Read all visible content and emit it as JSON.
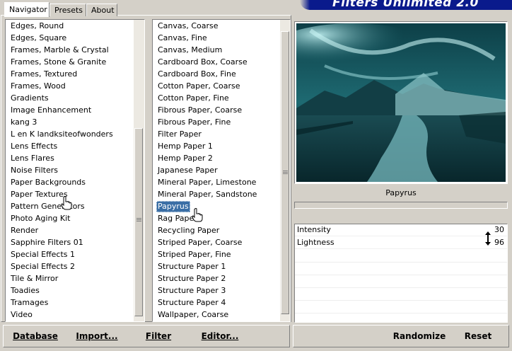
{
  "banner": {
    "title": "Filters Unlimited 2.0"
  },
  "tabs": [
    {
      "label": "Navigator",
      "active": true
    },
    {
      "label": "Presets",
      "active": false
    },
    {
      "label": "About",
      "active": false
    }
  ],
  "categories": {
    "items": [
      "Edges, Round",
      "Edges, Square",
      "Frames, Marble & Crystal",
      "Frames, Stone & Granite",
      "Frames, Textured",
      "Frames, Wood",
      "Gradients",
      "Image Enhancement",
      "kang 3",
      "L en K landksiteofwonders",
      "Lens Effects",
      "Lens Flares",
      "Noise Filters",
      "Paper Backgrounds",
      "Paper Textures",
      "Pattern Generators",
      "Photo Aging Kit",
      "Render",
      "Sapphire Filters 01",
      "Special Effects 1",
      "Special Effects 2",
      "Tile & Mirror",
      "Toadies",
      "Tramages",
      "Video"
    ],
    "hover_item": "Paper Textures"
  },
  "filters": {
    "items": [
      "Canvas, Coarse",
      "Canvas, Fine",
      "Canvas, Medium",
      "Cardboard Box, Coarse",
      "Cardboard Box, Fine",
      "Cotton Paper, Coarse",
      "Cotton Paper, Fine",
      "Fibrous Paper, Coarse",
      "Fibrous Paper, Fine",
      "Filter Paper",
      "Hemp Paper 1",
      "Hemp Paper 2",
      "Japanese Paper",
      "Mineral Paper, Limestone",
      "Mineral Paper, Sandstone",
      "Papyrus",
      "Rag Paper",
      "Recycling Paper",
      "Striped Paper, Coarse",
      "Striped Paper, Fine",
      "Structure Paper 1",
      "Structure Paper 2",
      "Structure Paper 3",
      "Structure Paper 4",
      "Wallpaper, Coarse"
    ],
    "selected": "Papyrus"
  },
  "preview": {
    "filter_name": "Papyrus"
  },
  "parameters": [
    {
      "label": "Intensity",
      "value": "30"
    },
    {
      "label": "Lightness",
      "value": "96"
    }
  ],
  "buttons": {
    "database": "Database",
    "import": "Import...",
    "filter_info": "Filter Info...",
    "editor": "Editor...",
    "randomize": "Randomize",
    "reset": "Reset"
  },
  "colors": {
    "selection": "#3a6ea5",
    "banner": "#0a1a8c",
    "preview_tint": "#1e6a72"
  },
  "icons": {
    "cursor": "hand-pointer-icon",
    "param_adjust": "up-down-arrow-icon"
  }
}
